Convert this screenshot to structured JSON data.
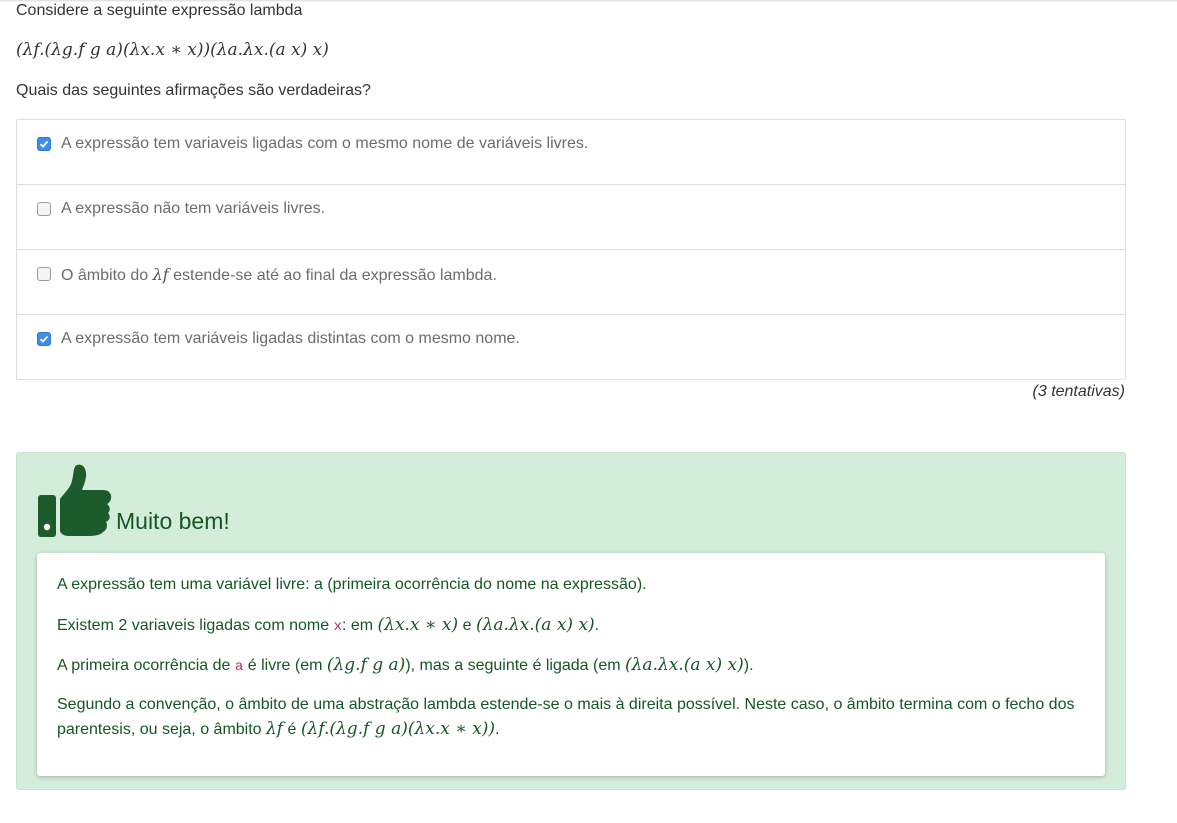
{
  "question": {
    "title": "Considere a seguinte expressão lambda",
    "expression": "(λf.(λg.f g a)(λx.x ∗ x))(λa.λx.(a x) x)",
    "prompt": "Quais das seguintes afirmações são verdadeiras?"
  },
  "options": [
    {
      "text": "A expressão tem variaveis ligadas com o mesmo nome de variáveis livres.",
      "checked": true
    },
    {
      "text": "A expressão não tem variáveis livres.",
      "checked": false
    },
    {
      "text_before": "O âmbito do",
      "math": "λf",
      "text_after": "estende-se até ao final da expressão lambda.",
      "checked": false
    },
    {
      "text": "A expressão tem variáveis ligadas distintas com o mesmo nome.",
      "checked": true
    }
  ],
  "attempts": "(3 tentativas)",
  "feedback": {
    "title": "Muito bem!",
    "icon": "thumbs-up-icon",
    "p1": "A expressão tem uma variável livre: a (primeira ocorrência do nome na expressão).",
    "p2": {
      "t1": "Existem 2 variaveis ligadas com nome",
      "code": "x",
      "t2": ": em",
      "m1": "(λx.x ∗ x)",
      "t3": "e",
      "m2": "(λa.λx.(a x) x)",
      "t4": "."
    },
    "p3": {
      "t1": "A primeira ocorrência de",
      "code": "a",
      "t2": "é livre (em",
      "m1": "(λg.f g a)",
      "t3": "), mas a seguinte é ligada (em",
      "m2": "(λa.λx.(a x) x)",
      "t4": ")."
    },
    "p4": {
      "t1": "Segundo a convenção, o âmbito de uma abstração lambda estende-se o mais à direita possível. Neste caso, o âmbito termina com o fecho dos parentesis, ou seja, o âmbito",
      "m1": "λf",
      "t2": "é",
      "m2": "(λf.(λg.f g a)(λx.x ∗ x))",
      "t3": "."
    }
  },
  "colors": {
    "feedback_bg": "#d4ecda",
    "feedback_text": "#155724",
    "icon": "#1e5b2c",
    "checkbox_checked": "#3d8fe8"
  }
}
